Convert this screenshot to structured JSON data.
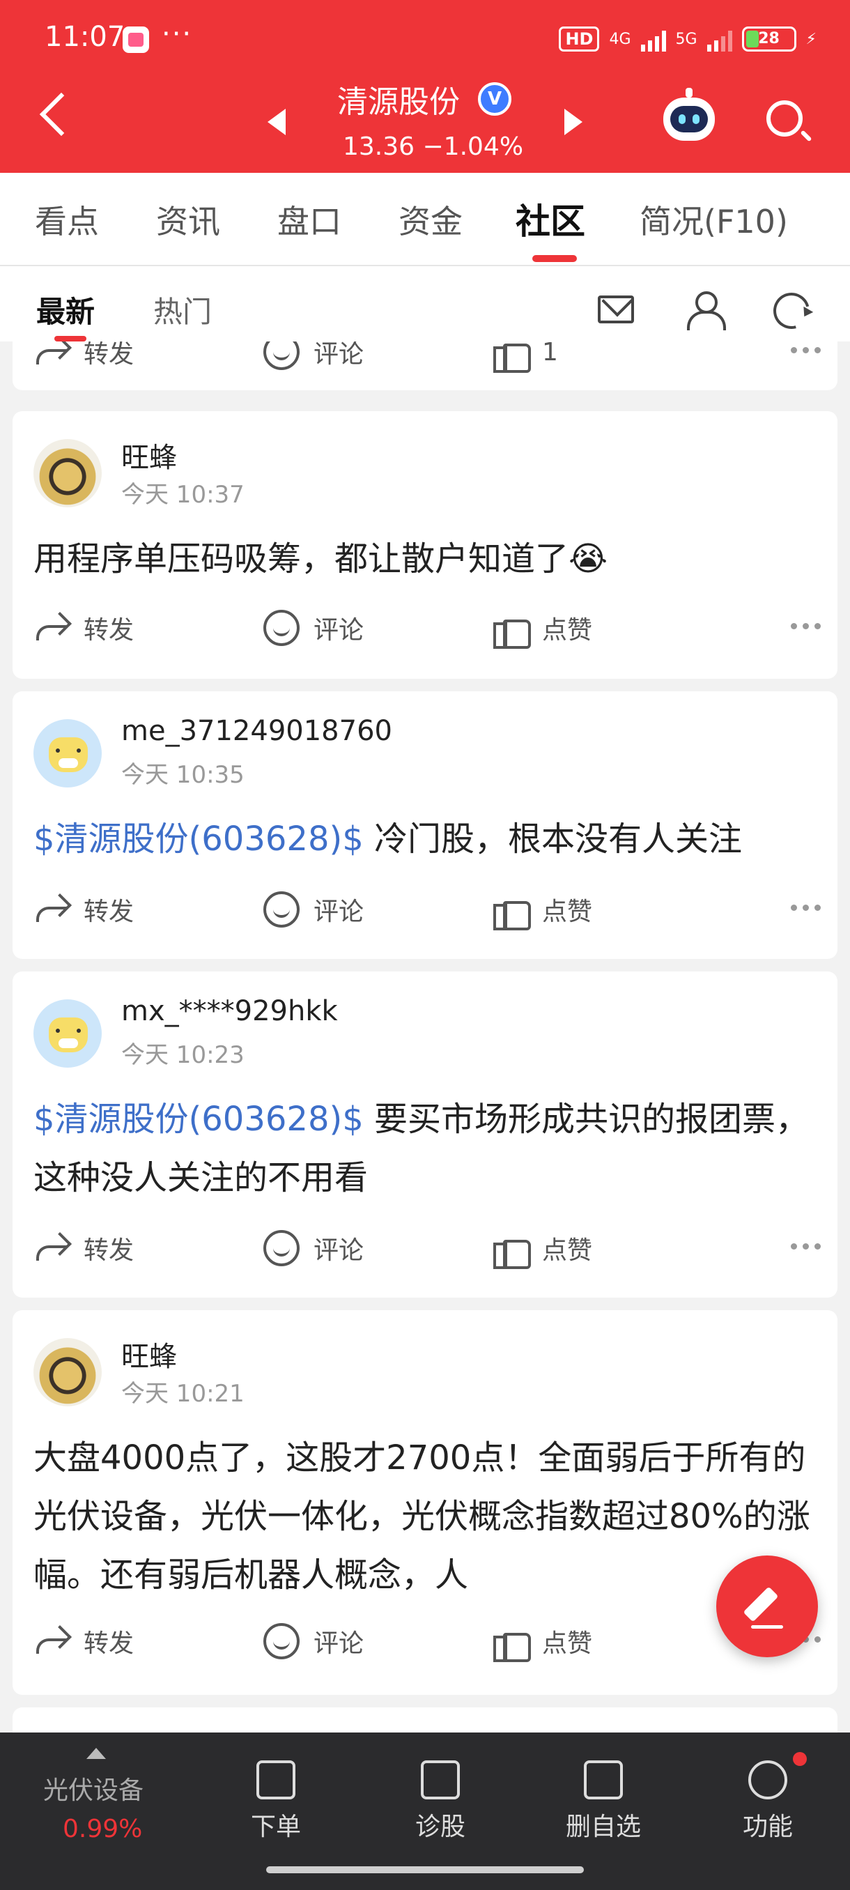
{
  "status_bar": {
    "time": "11:07",
    "dots": "···",
    "hd": "HD",
    "net1": "4G",
    "net2": "5G",
    "battery": "28"
  },
  "header": {
    "stock_name": "清源股份",
    "verified_badge": "V",
    "price_line": "13.36  −1.04%"
  },
  "tabs": [
    "看点",
    "资讯",
    "盘口",
    "资金",
    "社区",
    "简况(F10)"
  ],
  "active_tab": "社区",
  "subtabs": [
    "最新",
    "热门"
  ],
  "posts": [
    {
      "user": "旺蜂",
      "time": "今天 10:37",
      "tag": "",
      "text": "用程序单压码吸筹，都让散户知道了😭"
    },
    {
      "user": "me_371249018760",
      "time": "今天 10:35",
      "tag": "$清源股份(603628)$",
      "text": " 冷门股，根本没有人关注"
    },
    {
      "user": "mx_****929hkk",
      "time": "今天 10:23",
      "tag": "$清源股份(603628)$",
      "text": " 要买市场形成共识的报团票，这种没人关注的不用看"
    },
    {
      "user": "旺蜂",
      "time": "今天 10:21",
      "tag": "",
      "text": "大盘4000点了，这股才2700点！全面弱后于所有的光伏设备，光伏一体化，光伏概念指数超过80%的涨幅。还有弱后机器人概念，人"
    }
  ],
  "actions": {
    "share": "转发",
    "comment": "评论",
    "like": "点赞",
    "prev_like_count": "1"
  },
  "bottom_bar": {
    "sector_name": "光伏设备",
    "sector_change": "0.99%",
    "items": [
      "下单",
      "诊股",
      "删自选",
      "功能"
    ]
  },
  "colors": {
    "brand_red": "#ee3438",
    "link_blue": "#3e6fc9"
  }
}
